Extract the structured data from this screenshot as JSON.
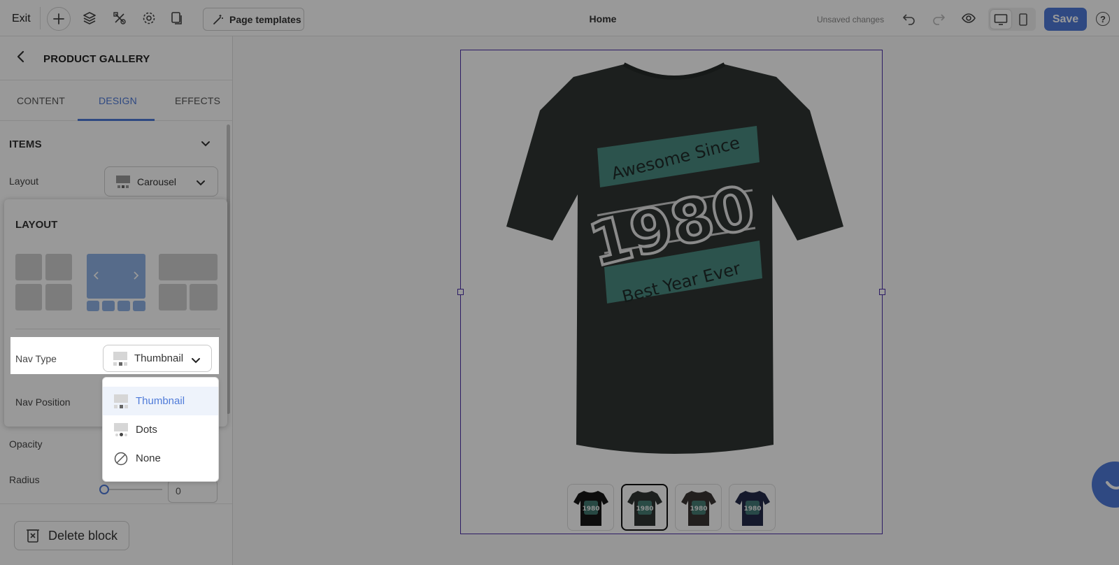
{
  "toolbar": {
    "exit_label": "Exit",
    "page_templates_label": "Page templates",
    "page_title": "Home",
    "unsaved_label": "Unsaved changes",
    "save_label": "Save",
    "help_label": "?"
  },
  "panel": {
    "title": "PRODUCT GALLERY",
    "tabs": [
      {
        "label": "CONTENT"
      },
      {
        "label": "DESIGN"
      },
      {
        "label": "EFFECTS"
      }
    ],
    "active_tab": "DESIGN",
    "items_section": {
      "title": "ITEMS",
      "layout_label": "Layout",
      "layout_value": "Carousel"
    },
    "layout_popover": {
      "title": "LAYOUT",
      "options": [
        "grid",
        "carousel",
        "featured-grid"
      ],
      "selected": "carousel"
    },
    "nav_type": {
      "label": "Nav Type",
      "value": "Thumbnail",
      "options": [
        {
          "label": "Thumbnail",
          "icon": "thumbnail-nav-icon",
          "selected": true
        },
        {
          "label": "Dots",
          "icon": "dots-nav-icon",
          "selected": false
        },
        {
          "label": "None",
          "icon": "none-circle-icon",
          "selected": false
        }
      ]
    },
    "nav_position_label": "Nav Position",
    "opacity_label": "Opacity",
    "radius_label": "Radius",
    "radius_value": "0",
    "delete_label": "Delete block"
  },
  "canvas": {
    "shirt_colors": [
      "#161616",
      "#2f3532",
      "#3a3533",
      "#232a4a"
    ],
    "selected_thumbnail": 2,
    "main_shirt_color": "#2f3532",
    "print_color": "#4a8a80",
    "print_text": {
      "top": "Awesome Since",
      "year": "1980",
      "bottom": "Best Year Ever"
    }
  },
  "colors": {
    "accent": "#4f7bd9",
    "selection_frame": "#4b2fa8"
  }
}
